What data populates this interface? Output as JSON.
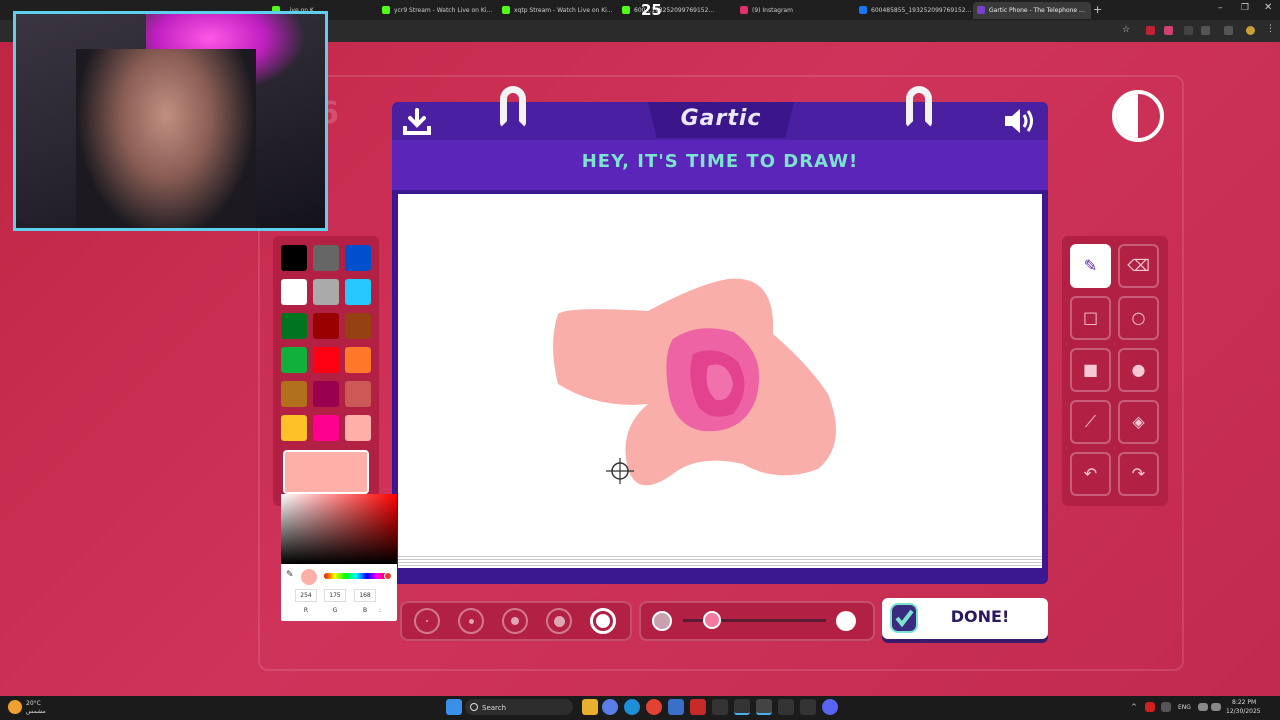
{
  "browser": {
    "tabs": [
      {
        "label": "...ive on K",
        "favicon_color": "#53fc18"
      },
      {
        "label": "ycr9 Stream - Watch Live on Ki...",
        "favicon_color": "#53fc18"
      },
      {
        "label": "xqtp Stream - Watch Live on Ki...",
        "favicon_color": "#53fc18"
      },
      {
        "label": "600...193252099769152...",
        "favicon_color": "#53fc18"
      },
      {
        "label": "(9) Instagram",
        "favicon_color": "#e1306c"
      },
      {
        "label": "600485855_193252099769152...",
        "favicon_color": "#1877f2"
      },
      {
        "label": "Gartic Phone - The Telephone ...",
        "favicon_color": "#7b3fd0"
      }
    ],
    "overlay_count": "25"
  },
  "game": {
    "logo": "Gartic",
    "headline": "HEY, IT'S TIME TO DRAW!",
    "done_label": "DONE!",
    "bg_number": "6"
  },
  "palette": {
    "colors": [
      "#000000",
      "#666666",
      "#0050cd",
      "#ffffff",
      "#aaaaaa",
      "#26c9ff",
      "#017420",
      "#990000",
      "#964112",
      "#11b03c",
      "#ff0013",
      "#ff7829",
      "#b0701c",
      "#99004e",
      "#cb5a57",
      "#ffc126",
      "#ff008f",
      "#feafa8"
    ],
    "current_color": "#feafa8"
  },
  "picker": {
    "rgb_values": [
      "254",
      "175",
      "168"
    ],
    "rgb_labels": [
      "R",
      "G",
      "B"
    ],
    "more": ":"
  },
  "tools": [
    {
      "name": "pencil-tool",
      "icon": "pencil-icon",
      "glyph": "✎",
      "selected": true
    },
    {
      "name": "eraser-tool",
      "icon": "eraser-icon",
      "glyph": "⌫",
      "selected": false
    },
    {
      "name": "rect-outline-tool",
      "icon": "square-outline-icon",
      "glyph": "□",
      "selected": false
    },
    {
      "name": "ellipse-outline-tool",
      "icon": "circle-outline-icon",
      "glyph": "○",
      "selected": false
    },
    {
      "name": "rect-fill-tool",
      "icon": "square-filled-icon",
      "glyph": "■",
      "selected": false
    },
    {
      "name": "ellipse-fill-tool",
      "icon": "circle-filled-icon",
      "glyph": "●",
      "selected": false
    },
    {
      "name": "line-tool",
      "icon": "line-icon",
      "glyph": "⟋",
      "selected": false
    },
    {
      "name": "fill-tool",
      "icon": "paint-bucket-icon",
      "glyph": "◈",
      "selected": false
    },
    {
      "name": "undo-tool",
      "icon": "undo-icon",
      "glyph": "↶",
      "selected": false
    },
    {
      "name": "redo-tool",
      "icon": "redo-icon",
      "glyph": "↷",
      "selected": false
    }
  ],
  "brush_sizes": {
    "count": 5,
    "selected_index": 4
  },
  "opacity": {
    "value": 0.2
  },
  "taskbar": {
    "weather_temp": "20°C",
    "weather_desc": "مشمس",
    "search_label": "Search",
    "lang": "ENG",
    "time": "8:22 PM",
    "date": "12/30/2025"
  }
}
